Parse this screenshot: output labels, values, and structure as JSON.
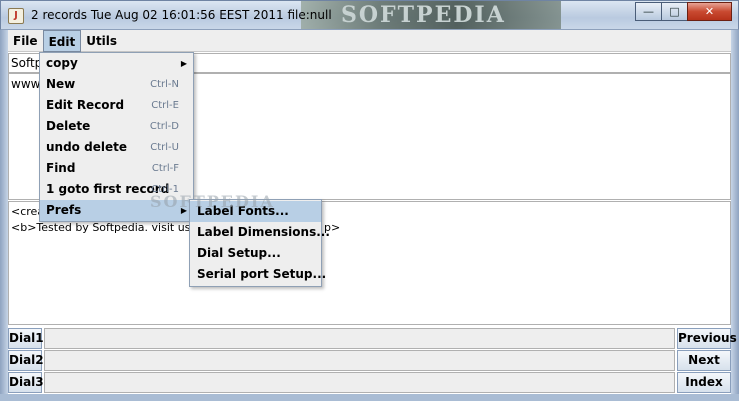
{
  "window": {
    "title": "2 records Tue Aug 02 16:01:56 EEST 2011 file:null",
    "title_watermark": "SOFTPEDIA",
    "minimize_glyph": "—",
    "maximize_glyph": "□",
    "close_glyph": "✕",
    "app_icon_glyph": "J"
  },
  "menubar": {
    "file": "File",
    "edit": "Edit",
    "utils": "Utils"
  },
  "content": {
    "field_text": "Softp",
    "area1_text": "www.",
    "area2_line1": "<crea",
    "area2_line2": "<b>Tested by Softpedia. visit us",
    "area2_line2_tail": "p>"
  },
  "edit_menu": {
    "items": [
      {
        "label": "copy",
        "shortcut": "",
        "submenu": true
      },
      {
        "label": "New",
        "shortcut": "Ctrl-N",
        "submenu": false
      },
      {
        "label": "Edit Record",
        "shortcut": "Ctrl-E",
        "submenu": false
      },
      {
        "label": "Delete",
        "shortcut": "Ctrl-D",
        "submenu": false
      },
      {
        "label": "undo delete",
        "shortcut": "Ctrl-U",
        "submenu": false
      },
      {
        "label": "Find",
        "shortcut": "Ctrl-F",
        "submenu": false
      },
      {
        "label": "1 goto first record",
        "shortcut": "Ctrl-1",
        "submenu": false
      },
      {
        "label": "Prefs",
        "shortcut": "",
        "submenu": true
      }
    ]
  },
  "prefs_submenu": {
    "items": [
      {
        "label": "Label Fonts..."
      },
      {
        "label": "Label Dimensions..."
      },
      {
        "label": "Dial Setup..."
      },
      {
        "label": "Serial port Setup..."
      }
    ]
  },
  "watermark": "SOFTPEDIA",
  "dials": [
    {
      "label": "Dial1",
      "nav": "Previous"
    },
    {
      "label": "Dial2",
      "nav": "Next"
    },
    {
      "label": "Dial3",
      "nav": "Index"
    }
  ],
  "colors": {
    "highlight": "#b8cfe5",
    "menu_bg": "#eeeeee"
  }
}
